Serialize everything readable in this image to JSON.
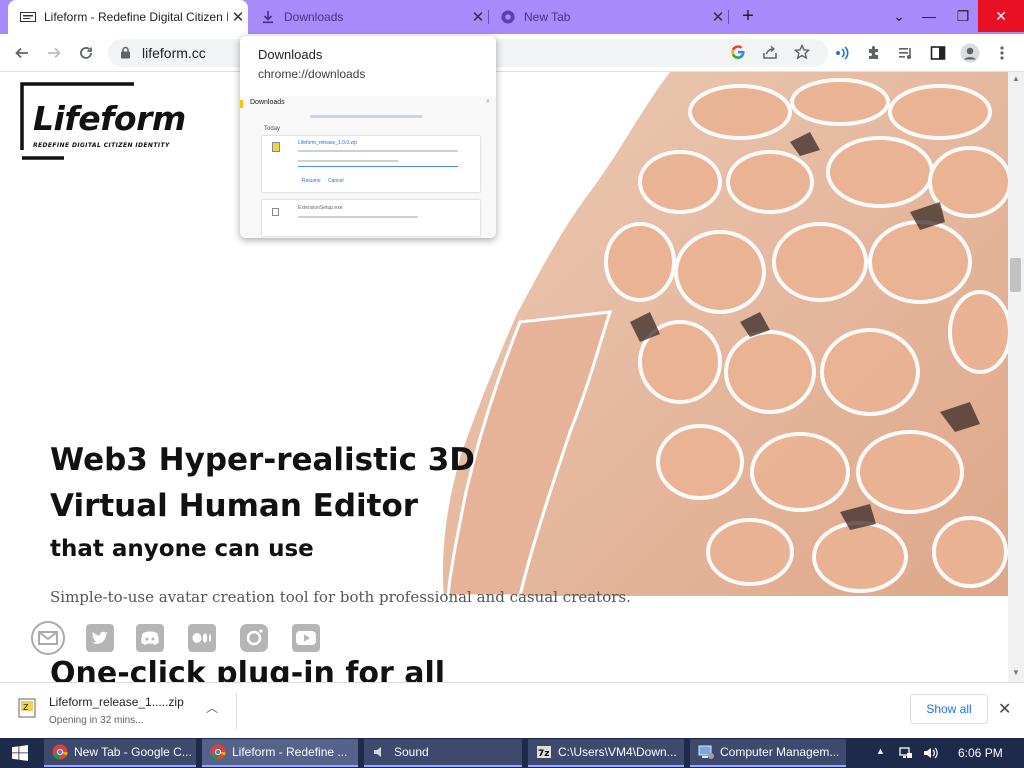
{
  "browser": {
    "tabs": [
      {
        "title": "Lifeform - Redefine Digital Citizen Identity",
        "active": true
      },
      {
        "title": "Downloads",
        "active": false
      },
      {
        "title": "New Tab",
        "active": false
      }
    ],
    "new_tab_symbol": "+",
    "address": "lifeform.cc"
  },
  "downloads_popup": {
    "title": "Downloads",
    "url": "chrome://downloads",
    "thumbnail": {
      "header": "Downloads",
      "section": "Today",
      "item1_name": "Lifeform_release_1.0.0.zip",
      "item1_link": "Resume",
      "item1_link2": "Cancel",
      "item2_name": "ExtensionSetup.exe"
    }
  },
  "page": {
    "logo_text": "Lifeform",
    "logo_tagline": "REDEFINE DIGITAL CITIZEN IDENTITY",
    "headline1": "Web3 Hyper-realistic 3D",
    "headline2": "Virtual Human Editor",
    "headline3": "that anyone can use",
    "subtitle": "Simple-to-use avatar creation tool for both professional and casual creators.",
    "next_heading": "One-click plug-in for all",
    "social_icons": [
      "email-icon",
      "twitter-icon",
      "discord-icon",
      "medium-icon",
      "instagram-icon",
      "youtube-icon"
    ]
  },
  "download_shelf": {
    "file_name": "Lifeform_release_1.....zip",
    "status": "Opening in 32 mins...",
    "show_all": "Show all"
  },
  "taskbar": {
    "items": [
      {
        "label": "New Tab - Google C..."
      },
      {
        "label": "Lifeform - Redefine ..."
      },
      {
        "label": "Sound"
      },
      {
        "label": "C:\\Users\\VM4\\Down..."
      },
      {
        "label": "Computer Managem..."
      }
    ],
    "time": "6:06 PM"
  },
  "colors": {
    "tabstrip": "#a78bfa",
    "taskbar": "#1e2a4a",
    "accent": "#1a73e8"
  }
}
